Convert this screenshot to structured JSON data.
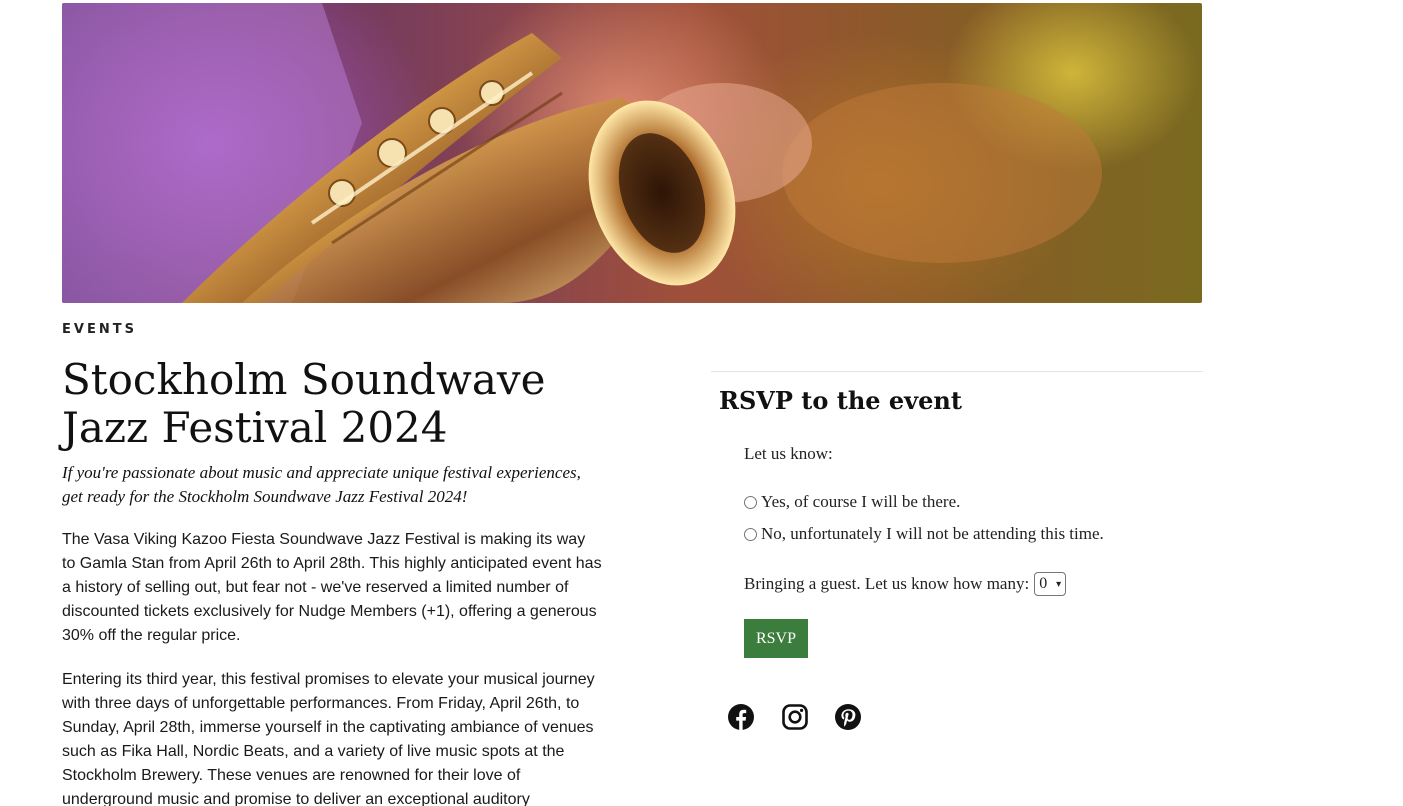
{
  "hero": {
    "image": "saxophone-player-photo"
  },
  "article": {
    "category": "EVENTS",
    "title": "Stockholm Soundwave Jazz Festival 2024",
    "lead": "If you're passionate about music and appreciate unique festival experiences, get ready for the Stockholm Soundwave Jazz Festival 2024!",
    "paragraphs": [
      "The Vasa Viking Kazoo Fiesta Soundwave Jazz Festival is making its way to Gamla Stan from April 26th to April 28th. This highly anticipated event has a history of selling out, but fear not - we've reserved a limited number of discounted tickets exclusively for Nudge Members (+1), offering a generous 30% off the regular price.",
      "Entering its third year, this festival promises to elevate your musical journey with three days of unforgettable performances. From Friday, April 26th, to Sunday, April 28th, immerse yourself in the captivating ambiance of venues such as Fika Hall, Nordic Beats, and a variety of live music spots at the Stockholm Brewery. These venues are renowned for their love of underground music and promise to deliver an exceptional auditory"
    ]
  },
  "rsvp": {
    "title": "RSVP to the event",
    "prompt": "Let us know:",
    "option_yes": "Yes, of course I will be there.",
    "option_no": "No, unfortunately I will not be attending this time.",
    "guest_label": "Bringing a guest. Let us know how many:",
    "guest_value": "0",
    "button_label": "RSVP",
    "button_color": "#3a7d3d"
  },
  "social": {
    "icons": [
      "facebook-icon",
      "instagram-icon",
      "pinterest-icon"
    ]
  }
}
